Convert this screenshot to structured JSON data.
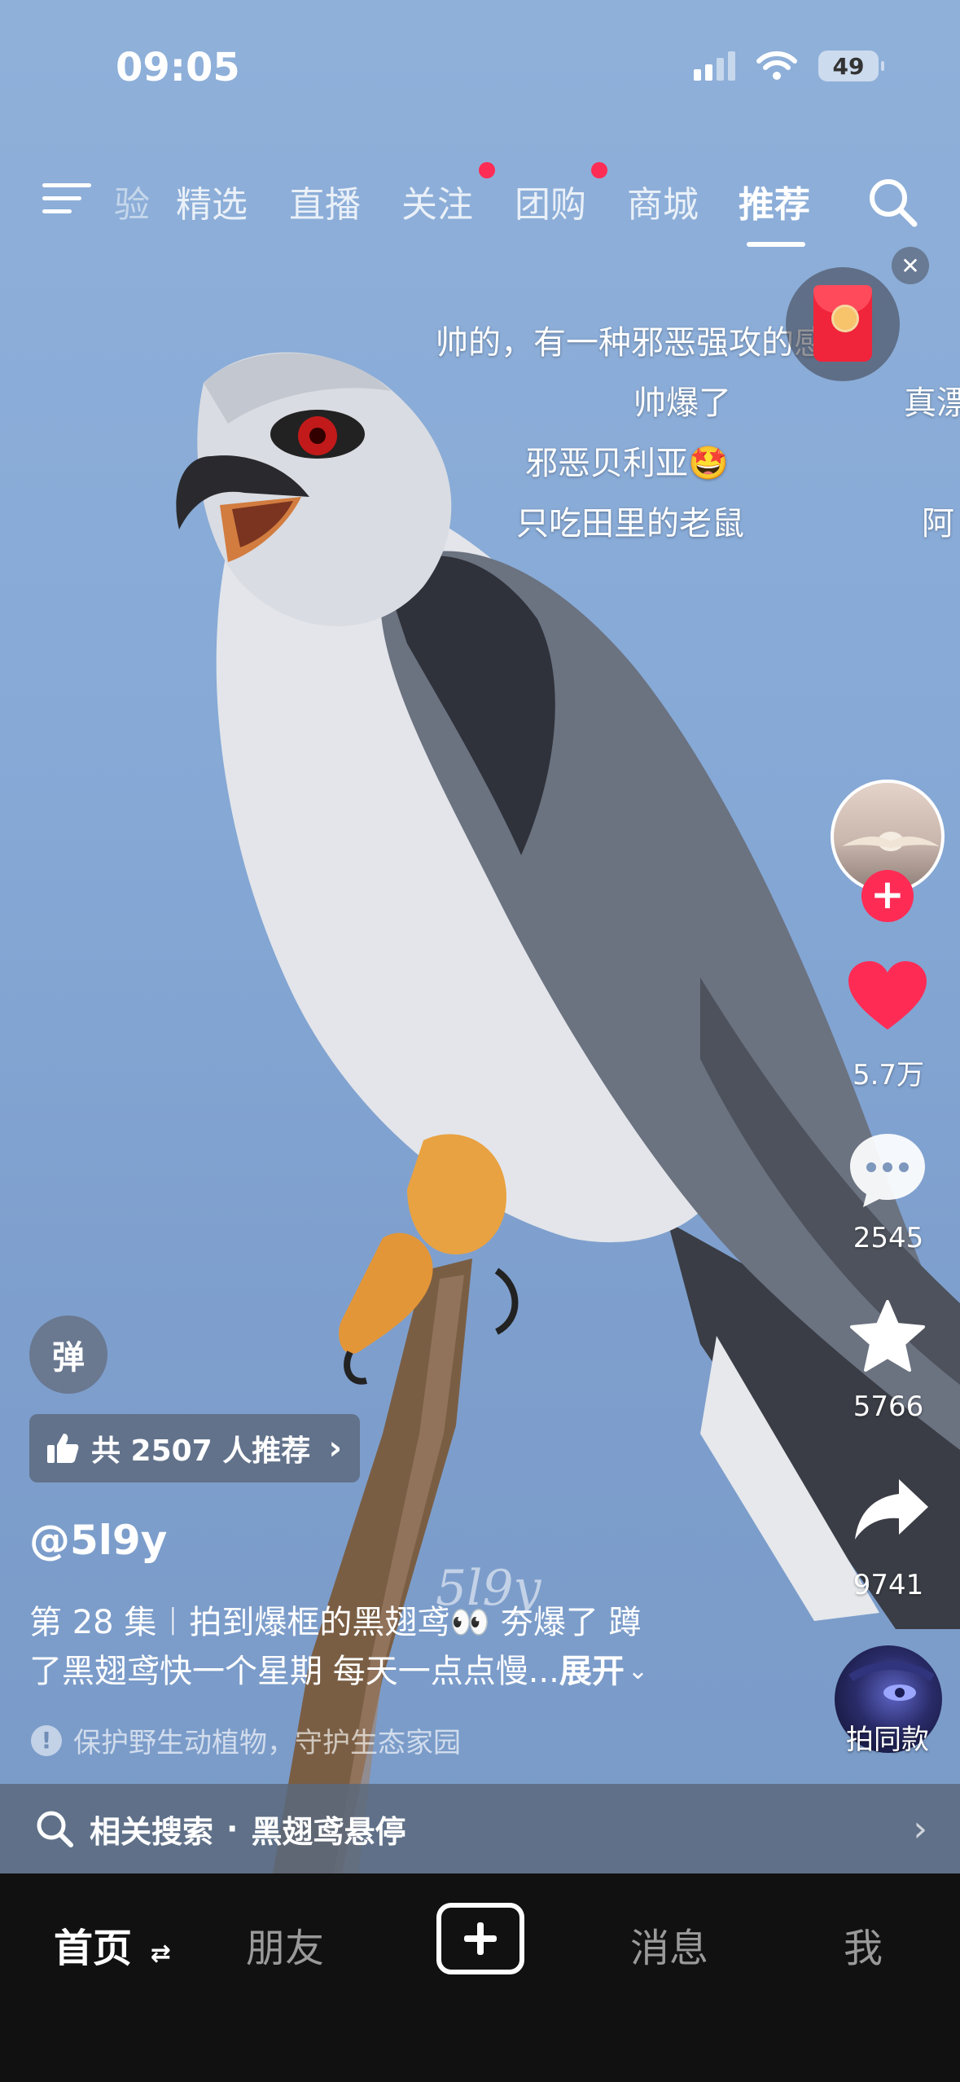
{
  "status_bar": {
    "time": "09:05",
    "battery": "49"
  },
  "top_nav": {
    "tabs": [
      {
        "label": "验"
      },
      {
        "label": "精选"
      },
      {
        "label": "直播"
      },
      {
        "label": "关注"
      },
      {
        "label": "团购"
      },
      {
        "label": "商城"
      },
      {
        "label": "推荐"
      }
    ],
    "active_tab": "推荐"
  },
  "danmaku": [
    "帅的，有一种邪恶强攻的感觉",
    "帅爆了",
    "真漂",
    "邪恶贝利亚🤩",
    "只吃田里的老鼠",
    "阿"
  ],
  "right_rail": {
    "likes": "5.7万",
    "comments": "2545",
    "favorites": "5766",
    "shares": "9741",
    "same_style_label": "拍同款"
  },
  "danmaku_toggle": "弹",
  "recommend_pill": "共 2507 人推荐",
  "author": "@5l9y",
  "description": {
    "line1": "第 28 集︱拍到爆框的黑翅鸢👀 夯爆了 蹲",
    "line2": "了黑翅鸢快一个星期 每天一点点慢...",
    "expand": "展开"
  },
  "watermark": "5l9y",
  "notice": "保护野生动植物，守护生态家园",
  "related_search": {
    "prefix": "相关搜索",
    "separator": "·",
    "query": "黑翅鸢悬停"
  },
  "tab_bar": {
    "home": "首页",
    "friends": "朋友",
    "messages": "消息",
    "me": "我"
  },
  "colors": {
    "accent": "#fe2c55",
    "sky": "#86a9d6",
    "tabbar": "#111111"
  }
}
